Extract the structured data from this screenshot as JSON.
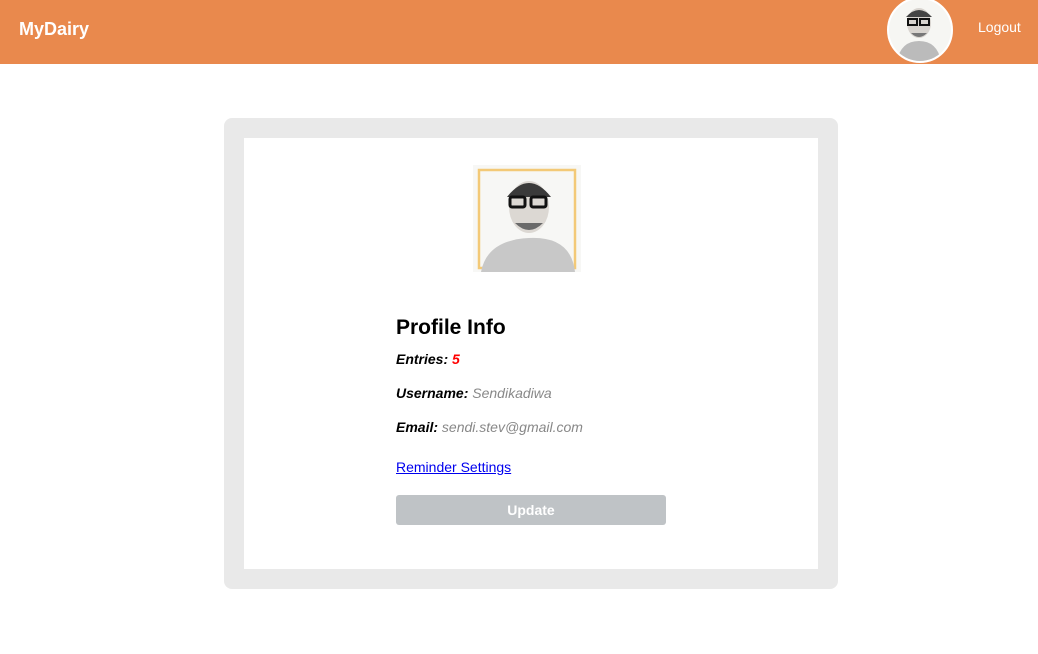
{
  "header": {
    "brand": "MyDairy",
    "logout": "Logout"
  },
  "profile": {
    "title": "Profile Info",
    "entries_label": "Entries:",
    "entries_value": "5",
    "username_label": "Username:",
    "username_value": "Sendikadiwa",
    "email_label": "Email:",
    "email_value": "sendi.stev@gmail.com",
    "reminder_link": "Reminder Settings",
    "update_button": "Update"
  },
  "colors": {
    "header": "#e9894d",
    "button": "#bfc3c6",
    "entries": "#ff0000",
    "frame": "#f3c977"
  }
}
